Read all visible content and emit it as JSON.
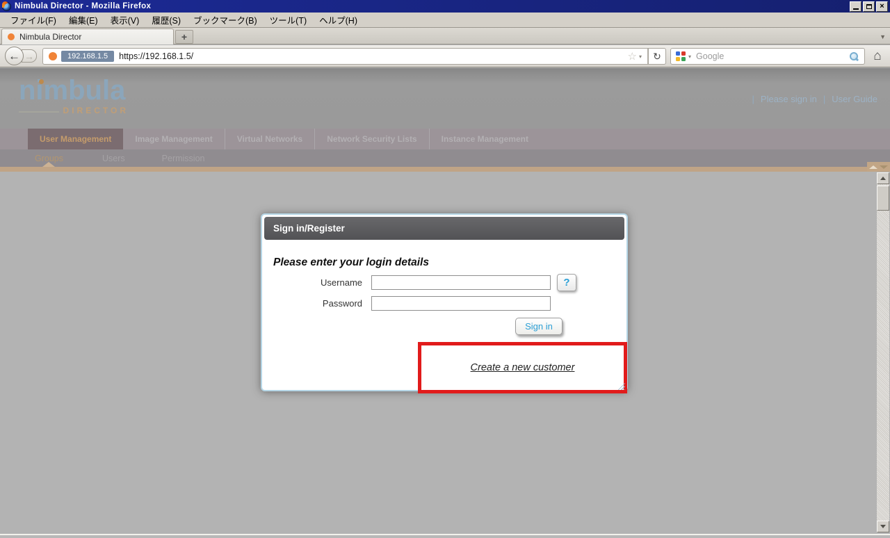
{
  "window": {
    "title": "Nimbula Director - Mozilla Firefox"
  },
  "menubar": {
    "items": [
      "ファイル(F)",
      "編集(E)",
      "表示(V)",
      "履歴(S)",
      "ブックマーク(B)",
      "ツール(T)",
      "ヘルプ(H)"
    ]
  },
  "tabbar": {
    "active_tab": "Nimbula Director",
    "new_tab": "+"
  },
  "navbar": {
    "back": "←",
    "forward": "→",
    "url_badge": "192.168.1.5",
    "url": "https://192.168.1.5/",
    "star": "☆",
    "caret": "▾",
    "reload": "↻",
    "search_placeholder": "Google",
    "home": "⌂"
  },
  "page": {
    "logo": {
      "name": "nimbula",
      "sub": "DIRECTOR"
    },
    "header_links": [
      "Please sign in",
      "User Guide"
    ],
    "pipe": "|",
    "nav_tabs": [
      {
        "label": "User Management"
      },
      {
        "label": "Image Management"
      },
      {
        "label": "Virtual Networks"
      },
      {
        "label": "Network Security Lists"
      },
      {
        "label": "Instance Management"
      }
    ],
    "subnav": [
      {
        "label": "Groups"
      },
      {
        "label": "Users"
      },
      {
        "label": "Permission"
      }
    ]
  },
  "dialog": {
    "title": "Sign in/Register",
    "prompt": "Please enter your login details",
    "username_label": "Username",
    "password_label": "Password",
    "help_button": "?",
    "signin_button": "Sign in",
    "create_link": "Create a new customer"
  },
  "colors": {
    "titlebar_blue": "#1c2a96",
    "favicon_orange": "#f08438",
    "url_badge_bg": "#7589a3",
    "logo_blue": "#8ba6bb",
    "logo_sub_orange": "#c09e76",
    "active_tab_bg": "#7b6c70",
    "active_tab_text": "#c59c6b",
    "accent_bar": "#c0a486",
    "dialog_header_bg": "#58585b",
    "dialog_border": "#b5d6e6",
    "button_text_blue": "#2b9fd6",
    "annotation_red": "#e11b1b"
  }
}
